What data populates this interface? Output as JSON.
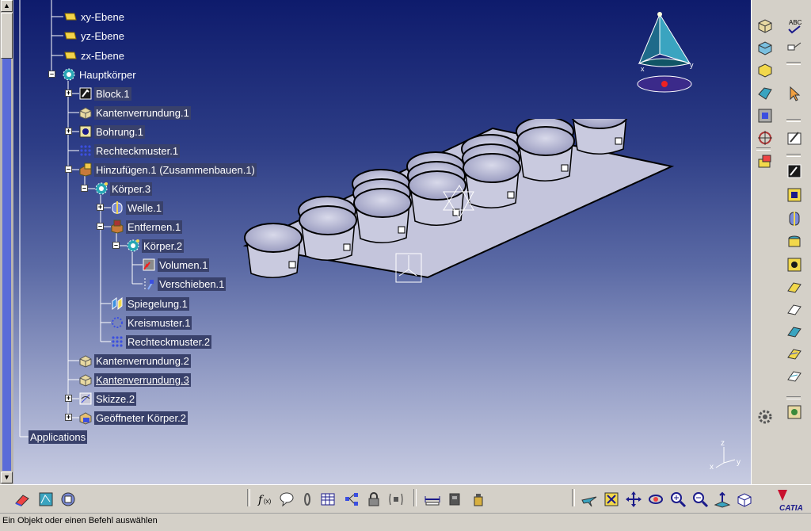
{
  "tree": {
    "items": [
      {
        "label": "xy-Ebene",
        "icon": "plane-icon"
      },
      {
        "label": "yz-Ebene",
        "icon": "plane-icon"
      },
      {
        "label": "zx-Ebene",
        "icon": "plane-icon"
      },
      {
        "label": "Hauptkörper",
        "icon": "body-gear-icon"
      },
      {
        "label": "Block.1",
        "icon": "pad-icon"
      },
      {
        "label": "Kantenverrundung.1",
        "icon": "edge-fillet-icon"
      },
      {
        "label": "Bohrung.1",
        "icon": "hole-icon"
      },
      {
        "label": "Rechteckmuster.1",
        "icon": "rect-pattern-icon"
      },
      {
        "label": "Hinzufügen.1 (Zusammenbauen.1)",
        "icon": "add-icon"
      },
      {
        "label": "Körper.3",
        "icon": "body-gear-icon"
      },
      {
        "label": "Welle.1",
        "icon": "shaft-icon"
      },
      {
        "label": "Entfernen.1",
        "icon": "remove-icon"
      },
      {
        "label": "Körper.2",
        "icon": "body-gear-icon"
      },
      {
        "label": "Volumen.1",
        "icon": "volume-icon"
      },
      {
        "label": "Verschieben.1",
        "icon": "translate-icon"
      },
      {
        "label": "Spiegelung.1",
        "icon": "mirror-icon"
      },
      {
        "label": "Kreismuster.1",
        "icon": "circ-pattern-icon"
      },
      {
        "label": "Rechteckmuster.2",
        "icon": "rect-pattern-icon"
      },
      {
        "label": "Kantenverrundung.2",
        "icon": "edge-fillet-icon"
      },
      {
        "label": "Kantenverrundung.3",
        "icon": "edge-fillet-icon"
      },
      {
        "label": "Skizze.2",
        "icon": "sketch-icon"
      },
      {
        "label": "Geöffneter Körper.2",
        "icon": "open-body-icon"
      }
    ],
    "applications_label": "Applications"
  },
  "compass": {
    "x_label": "x",
    "y_label": "y"
  },
  "axis_triad": {
    "x": "x",
    "y": "y",
    "z": "z"
  },
  "status": {
    "text": "Ein Objekt oder einen Befehl auswählen"
  },
  "brand": {
    "name": "CATIA",
    "accent": "#c8102e"
  },
  "colors": {
    "viewport_top": "#0e1b6c",
    "viewport_bottom": "#c8cce2",
    "tree_text": "#ffffff"
  }
}
